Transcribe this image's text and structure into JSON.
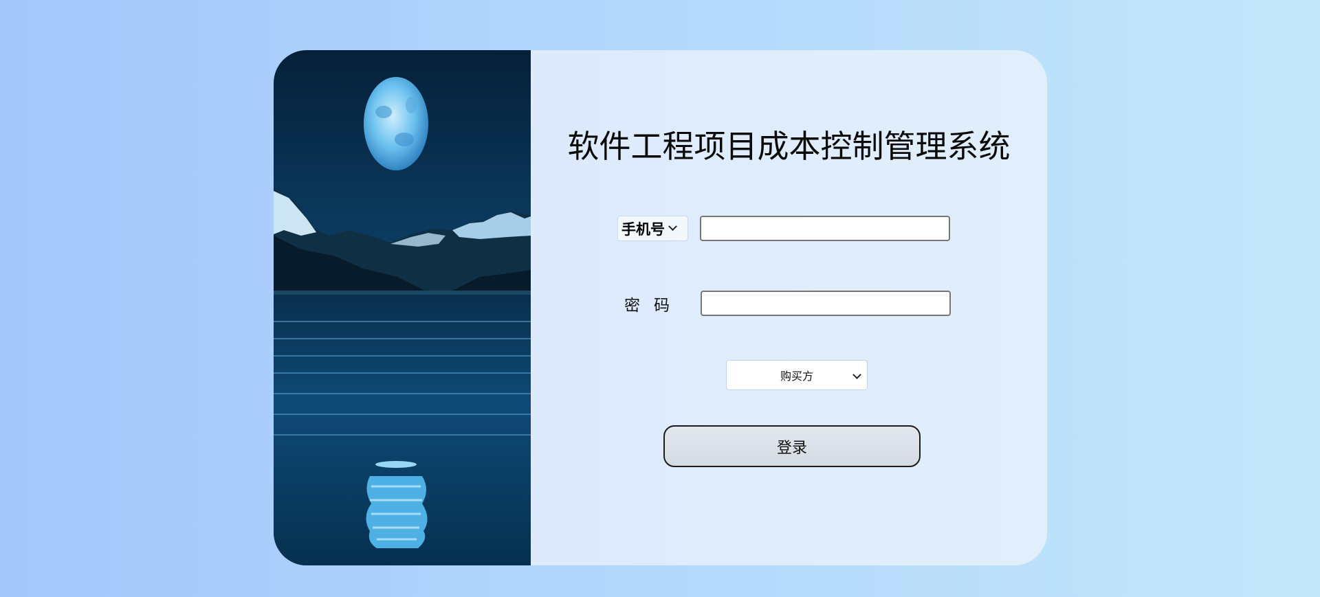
{
  "login": {
    "title": "软件工程项目成本控制管理系统",
    "account_type_selected": "手机号",
    "phone_value": "",
    "password_label": "密码",
    "password_value": "",
    "role_selected": "购买方",
    "submit_label": "登录"
  },
  "art": {
    "description_icon": "moon-lake-illustration-icon"
  }
}
